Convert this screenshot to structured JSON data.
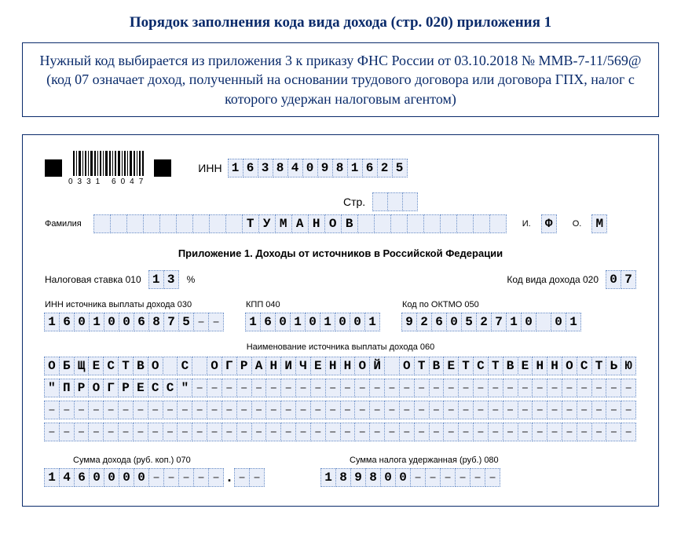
{
  "title": "Порядок заполнения кода вида дохода (стр. 020) приложения 1",
  "intro": "Нужный код выбирается из приложения 3 к приказу ФНС России от 03.10.2018 № ММВ-7-11/569@ (код 07 означает доход, полученный на основании трудового договора или договора ГПХ, налог с которого удержан налоговым агентом)",
  "barcode_num": "0331   6047",
  "labels": {
    "inn": "ИНН",
    "str": "Стр.",
    "familia": "Фамилия",
    "i": "И.",
    "o": "О.",
    "subtitle": "Приложение 1. Доходы от источников в Российской Федерации",
    "tax_rate": "Налоговая ставка   010",
    "percent": "%",
    "income_code": "Код вида дохода   020",
    "inn_src": "ИНН источника выплаты дохода   030",
    "kpp": "КПП   040",
    "oktmo": "Код по ОКТМО   050",
    "src_name": "Наименование источника выплаты дохода   060",
    "sum_income": "Сумма дохода (руб. коп.)   070",
    "sum_tax": "Сумма налога удержанная (руб.)   080"
  },
  "values": {
    "inn": "163840981625",
    "str": "   ",
    "familia": "ТУМАНОВ",
    "i": "Ф",
    "o": "М",
    "tax_rate": "13",
    "income_code": "07",
    "inn_src": "1601006875",
    "inn_src_dash": 2,
    "kpp": "160101001",
    "oktmo": "926052710 01",
    "name_line1": "ОБЩЕСТВО С ОГРАНИЧЕННОЙ ОТВЕТСТВЕННОСТЬЮ",
    "name_line2": "\"ПРОГРЕСС\"",
    "name_width": 40,
    "sum_income_rub": "1460000",
    "sum_income_rub_width": 12,
    "sum_income_kop_width": 2,
    "sum_tax": "189800",
    "sum_tax_width": 12
  }
}
